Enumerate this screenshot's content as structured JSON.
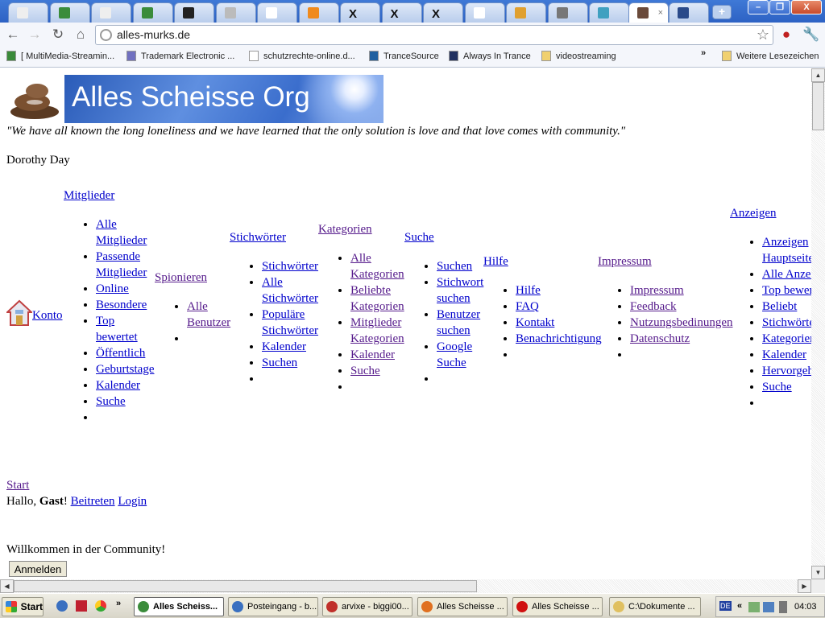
{
  "browser": {
    "tabs": [
      {
        "fav": "#eeeeee"
      },
      {
        "fav": "#3b8c3b"
      },
      {
        "fav": "#eeeeee"
      },
      {
        "fav": "#3b8c3b"
      },
      {
        "fav": "#222222"
      },
      {
        "fav": "#bbbbbb"
      },
      {
        "fav": "#ffffff"
      },
      {
        "fav": "#f08a1c"
      },
      {
        "fav": "x"
      },
      {
        "fav": "x"
      },
      {
        "fav": "x"
      },
      {
        "fav": "#ffffff"
      },
      {
        "fav": "#e0a030"
      },
      {
        "fav": "#777777"
      },
      {
        "fav": "#40a0c0"
      },
      {
        "fav": "#6a4a3a",
        "active": true
      },
      {
        "fav": "#2a4a8a"
      }
    ],
    "close_label": "×",
    "new_tab_label": "+",
    "window_controls": {
      "minimize": "–",
      "maximize": "❐",
      "close": "X"
    },
    "url": "alles-murks.de",
    "bookmarks": [
      "[ MultiMedia-Streamin...",
      "Trademark Electronic ...",
      "schutzrechte-online.d...",
      "TranceSource",
      "Always In Trance",
      "videostreaming"
    ],
    "bookmarks_overflow": "»",
    "other_bookmarks": "Weitere Lesezeichen"
  },
  "page": {
    "site_title": "Alles Scheisse Org",
    "quote": "\"We have all known the long loneliness and we have learned that the only solution is love and that love comes with community.\"",
    "quote_author": "Dorothy Day",
    "konto": "Konto",
    "menus": [
      {
        "title": "Mitglieder",
        "items": [
          "Alle\nMitglieder",
          "Passende\nMitglieder",
          "Online",
          "Besondere",
          "Top\nbewertet",
          "Öffentlich",
          "Geburtstage",
          "Kalender",
          "Suche",
          ""
        ]
      },
      {
        "title": "Spionieren",
        "visited": true,
        "items": [
          "Alle\nBenutzer",
          ""
        ]
      },
      {
        "title": "Stichwörter",
        "items": [
          "Stichwörter",
          "Alle\nStichwörter",
          "Populäre\nStichwörter",
          "Kalender",
          "Suchen",
          ""
        ]
      },
      {
        "title": "Kategorien",
        "visited": true,
        "items": [
          "Alle\nKategorien",
          "Beliebte\nKategorien",
          "Mitglieder\nKategorien",
          "Kalender",
          "Suche",
          ""
        ]
      },
      {
        "title": "Suche",
        "items": [
          "Suchen",
          "Stichwort\nsuchen",
          "Benutzer\nsuchen",
          "Google\nSuche",
          ""
        ]
      },
      {
        "title": "Hilfe",
        "items": [
          "Hilfe",
          "FAQ",
          "Kontakt",
          "Benachrichtigung",
          ""
        ]
      },
      {
        "title": "Impressum",
        "visited": true,
        "items": [
          "Impressum",
          "Feedback",
          "Nutzungsbedinungen",
          "Datenschutz",
          ""
        ]
      },
      {
        "title": "Anzeigen",
        "items": [
          "Anzeigen\nHauptseite",
          "Alle Anzeigen",
          "Top bewertet",
          "Beliebt",
          "Stichwörter",
          "Kategorien",
          "Kalender",
          "Hervorgehoben",
          "Suche",
          ""
        ]
      }
    ],
    "start": "Start",
    "greeting_prefix": "Hallo, ",
    "greeting_user": "Gast",
    "greeting_suffix": "! ",
    "join": "Beitreten",
    "login": "Login",
    "welcome": "Willkommen in der Community!",
    "anmelden": "Anmelden"
  },
  "taskbar": {
    "start": "Start",
    "overflow": "»",
    "items": [
      {
        "label": "Alles Scheiss...",
        "color": "#3b8c3b",
        "active": true
      },
      {
        "label": "Posteingang - b...",
        "color": "#3a70c0"
      },
      {
        "label": "arvixe - biggi00...",
        "color": "#c0302a"
      },
      {
        "label": "Alles Scheisse ...",
        "color": "#e07020"
      },
      {
        "label": "Alles Scheisse ...",
        "color": "#d01010"
      },
      {
        "label": "C:\\Dokumente ...",
        "color": "#e0c060"
      }
    ],
    "lang": "DE",
    "tray_arrow": "«",
    "clock": "04:03"
  },
  "colors": {
    "link": "#0000cc",
    "visited": "#551a8b"
  }
}
